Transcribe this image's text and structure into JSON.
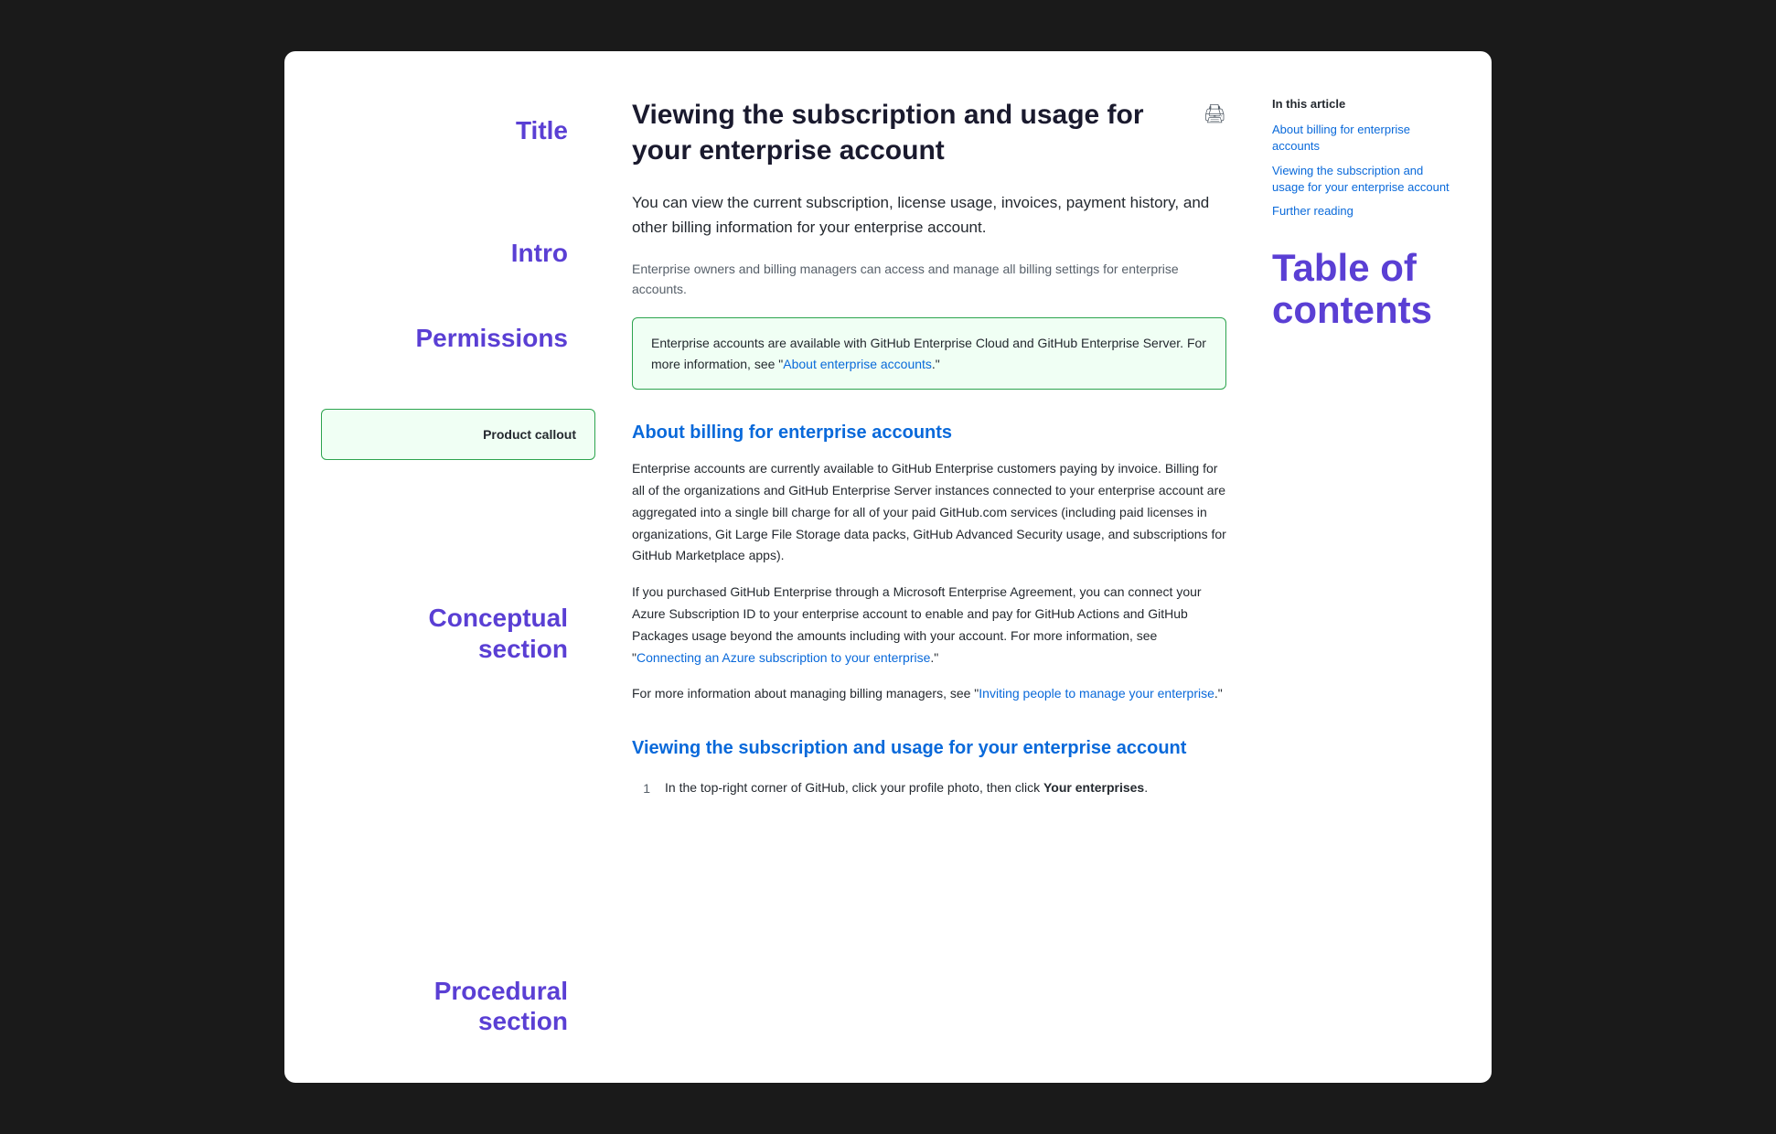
{
  "window": {
    "background": "#ffffff"
  },
  "annotations": {
    "title": "Title",
    "intro": "Intro",
    "permissions": "Permissions",
    "product_callout": "Product callout",
    "conceptual": "Conceptual section",
    "procedural": "Procedural section"
  },
  "article": {
    "title": "Viewing the subscription and usage for your enterprise account",
    "intro": "You can view the current subscription, license usage, invoices, payment history, and other billing information for your enterprise account.",
    "permissions_text": "Enterprise owners and billing managers can access and manage all billing settings for enterprise accounts.",
    "product_callout": {
      "text": "Enterprise accounts are available with GitHub Enterprise Cloud and GitHub Enterprise Server. For more information, see \"",
      "link_text": "About enterprise accounts",
      "text_end": ".\""
    },
    "conceptual_heading": "About billing for enterprise accounts",
    "conceptual_body_1": "Enterprise accounts are currently available to GitHub Enterprise customers paying by invoice. Billing for all of the organizations and GitHub Enterprise Server instances connected to your enterprise account are aggregated into a single bill charge for all of your paid GitHub.com services (including paid licenses in organizations, Git Large File Storage data packs, GitHub Advanced Security usage, and subscriptions for GitHub Marketplace apps).",
    "conceptual_body_2_before": "If you purchased GitHub Enterprise through a Microsoft Enterprise Agreement, you can connect your Azure Subscription ID to your enterprise account to enable and pay for GitHub Actions and GitHub Packages usage beyond the amounts including with your account. For more information, see \"",
    "conceptual_body_2_link": "Connecting an Azure subscription to your enterprise",
    "conceptual_body_2_after": ".\"",
    "conceptual_body_3_before": "For more information about managing billing managers, see \"",
    "conceptual_body_3_link": "Inviting people to manage your enterprise",
    "conceptual_body_3_after": ".\"",
    "procedural_heading": "Viewing the subscription and usage for your enterprise account",
    "steps": [
      {
        "number": "1",
        "text_before": "In the top-right corner of GitHub, click your profile photo, then click ",
        "text_bold": "Your enterprises",
        "text_after": "."
      }
    ]
  },
  "toc": {
    "in_this_article": "In this article",
    "links": [
      "About billing for enterprise accounts",
      "Viewing the subscription and usage for your enterprise account",
      "Further reading"
    ],
    "heading_line1": "Table of",
    "heading_line2": "contents"
  }
}
